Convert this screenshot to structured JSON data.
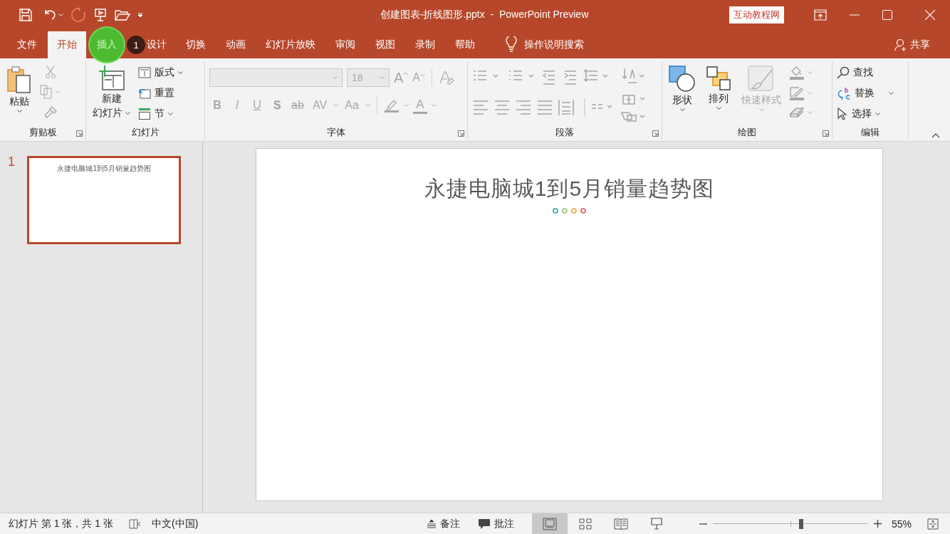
{
  "window": {
    "title": "创建图表-折线图形.pptx  -  PowerPoint Preview",
    "badge": "互动教程网"
  },
  "tabs": [
    {
      "label": "文件",
      "selected": false,
      "highlighted": false
    },
    {
      "label": "开始",
      "selected": true,
      "highlighted": false
    },
    {
      "label": "插入",
      "selected": false,
      "highlighted": true
    },
    {
      "label": "设计",
      "selected": false,
      "highlighted": false,
      "badge": "1"
    },
    {
      "label": "切换",
      "selected": false,
      "highlighted": false
    },
    {
      "label": "动画",
      "selected": false,
      "highlighted": false
    },
    {
      "label": "幻灯片放映",
      "selected": false,
      "highlighted": false
    },
    {
      "label": "审阅",
      "selected": false,
      "highlighted": false
    },
    {
      "label": "视图",
      "selected": false,
      "highlighted": false
    },
    {
      "label": "录制",
      "selected": false,
      "highlighted": false
    },
    {
      "label": "帮助",
      "selected": false,
      "highlighted": false
    }
  ],
  "tell_me": "操作说明搜索",
  "share": "共享",
  "ribbon": [
    {
      "kind": "clipboard",
      "label": "剪贴板",
      "launcher": true,
      "paste": "粘贴"
    },
    {
      "kind": "slides",
      "label": "幻灯片",
      "launcher": false,
      "new_slide": [
        "新建",
        "幻灯片"
      ],
      "layout": "版式",
      "reset": "重置",
      "section": "节"
    },
    {
      "kind": "font",
      "label": "字体",
      "launcher": true,
      "disabled": true,
      "font_size": "18",
      "size_buttons": [
        "A",
        "A"
      ],
      "format_buttons": [
        {
          "kind": "bold",
          "label": "B"
        },
        {
          "kind": "italic",
          "label": "I"
        },
        {
          "kind": "underline",
          "label": "U"
        },
        {
          "kind": "shadow",
          "label": "S"
        },
        {
          "kind": "strike",
          "label": "ab"
        },
        {
          "kind": "spacing",
          "label": "AV"
        },
        {
          "kind": "case",
          "label": "Aa"
        }
      ],
      "font_color": "A"
    },
    {
      "kind": "paragraph",
      "label": "段落",
      "launcher": true,
      "disabled": true
    },
    {
      "kind": "drawing",
      "label": "绘图",
      "launcher": true,
      "shapes": "形状",
      "arrange": "排列",
      "quick_styles": {
        "label": "快速样式",
        "disabled": true
      }
    },
    {
      "kind": "editing",
      "label": "编辑",
      "launcher": false,
      "find": "查找",
      "replace": "替换",
      "select": "选择"
    }
  ],
  "thumbnails": [
    {
      "number": "1",
      "title": "永捷电脑城1到5月销量趋势图",
      "selected": true
    }
  ],
  "slide": {
    "title": "永捷电脑城1到5月销量趋势图",
    "dots": [
      {
        "color": "#2aa39a"
      },
      {
        "color": "#9bbf6a"
      },
      {
        "color": "#e8a53a"
      },
      {
        "color": "#d05a4a"
      }
    ]
  },
  "status_bar": {
    "slide_info": "幻灯片 第 1 张，共 1 张",
    "language": "中文(中国)",
    "notes": "备注",
    "comments": "批注",
    "views": [
      {
        "kind": "normal",
        "selected": true
      },
      {
        "kind": "sorter",
        "selected": false
      },
      {
        "kind": "reading",
        "selected": false
      },
      {
        "kind": "slideshow",
        "selected": false
      }
    ],
    "zoom": {
      "level": 0.57,
      "reading": "55%"
    }
  }
}
